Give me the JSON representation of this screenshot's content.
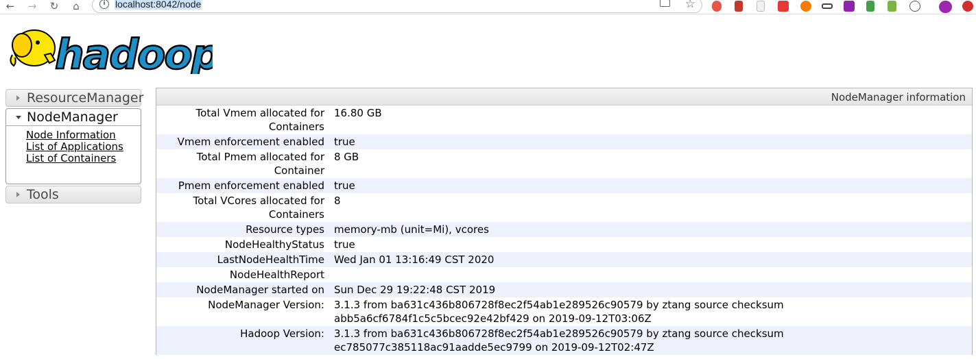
{
  "browser": {
    "url": "localhost:8042/node"
  },
  "sidebar": {
    "resourcemanager_label": "ResourceManager",
    "nodemanager_label": "NodeManager",
    "nodemanager_links": [
      "Node Information",
      "List of Applications",
      "List of Containers"
    ],
    "tools_label": "Tools"
  },
  "info": {
    "caption": "NodeManager information",
    "rows": [
      {
        "key": "Total Vmem allocated for Containers",
        "value": "16.80 GB"
      },
      {
        "key": "Vmem enforcement enabled",
        "value": "true"
      },
      {
        "key": "Total Pmem allocated for Container",
        "value": "8 GB"
      },
      {
        "key": "Pmem enforcement enabled",
        "value": "true"
      },
      {
        "key": "Total VCores allocated for Containers",
        "value": "8"
      },
      {
        "key": "Resource types",
        "value": "memory-mb (unit=Mi), vcores"
      },
      {
        "key": "NodeHealthyStatus",
        "value": "true"
      },
      {
        "key": "LastNodeHealthTime",
        "value": "Wed Jan 01 13:16:49 CST 2020"
      },
      {
        "key": "NodeHealthReport",
        "value": ""
      },
      {
        "key": "NodeManager started on",
        "value": "Sun Dec 29 19:22:48 CST 2019"
      },
      {
        "key": "NodeManager Version:",
        "value": "3.1.3 from ba631c436b806728f8ec2f54ab1e289526c90579 by ztang source checksum abb5a6cf6784f1c5c5bcec92e42bf429 on 2019-09-12T03:06Z"
      },
      {
        "key": "Hadoop Version:",
        "value": "3.1.3 from ba631c436b806728f8ec2f54ab1e289526c90579 by ztang source checksum ec785077c385118ac91aadde5ec9799 on 2019-09-12T02:47Z"
      }
    ]
  },
  "colors": {
    "row_alt": "#eef0fb",
    "logo_blue": "#1e90c8",
    "logo_yellow": "#ffe600"
  }
}
